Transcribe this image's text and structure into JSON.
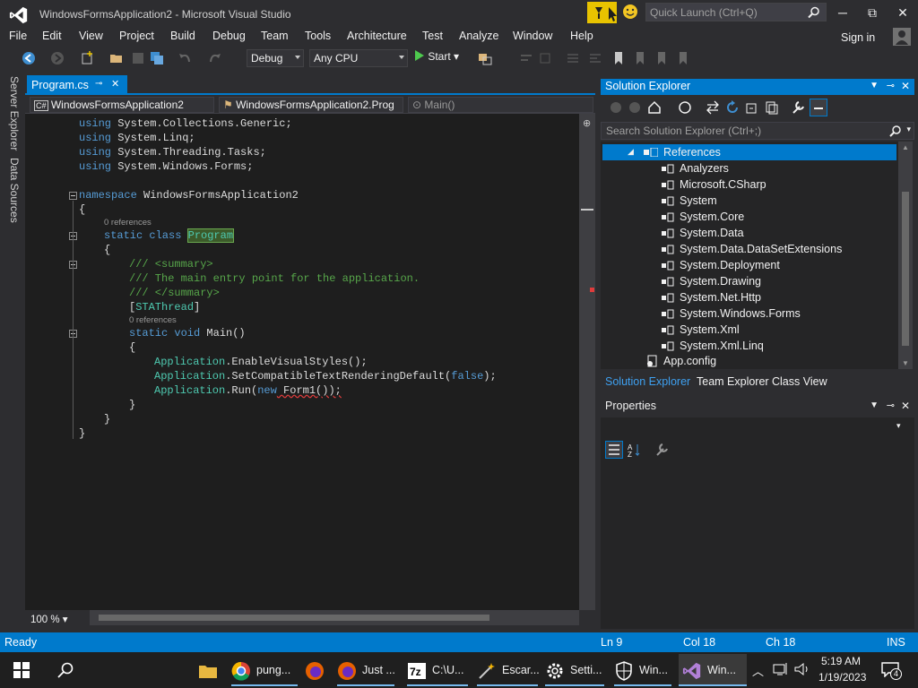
{
  "window": {
    "title": "WindowsFormsApplication2 - Microsoft Visual Studio",
    "quick_launch_placeholder": "Quick Launch (Ctrl+Q)",
    "minimize": "─",
    "maximize": "⧉",
    "close": "✕",
    "sign_in": "Sign in"
  },
  "menu": [
    "File",
    "Edit",
    "View",
    "Project",
    "Build",
    "Debug",
    "Team",
    "Tools",
    "Architecture",
    "Test",
    "Analyze",
    "Window",
    "Help"
  ],
  "toolbar": {
    "config": "Debug",
    "platform": "Any CPU",
    "start": "Start"
  },
  "left_tabs": [
    "Server Explorer",
    "Data Sources"
  ],
  "editor": {
    "tab": "Program.cs",
    "nav_project": "WindowsFormsApplication2",
    "nav_class": "WindowsFormsApplication2.Prog",
    "nav_member": "Main()",
    "zoom": "100 %",
    "lines": {
      "u1_kw": "using",
      "u1": " System.Collections.Generic;",
      "u2_kw": "using",
      "u2": " System.Linq;",
      "u3_kw": "using",
      "u3": " System.Threading.Tasks;",
      "u4_kw": "using",
      "u4": " System.Windows.Forms;",
      "ns_kw": "namespace",
      "ns": " WindowsFormsApplication2",
      "brace_open": "{",
      "refs1": "0 references",
      "cls_kw": "static class",
      "cls_name": "Program",
      "brace2": "{",
      "c1": "/// <summary>",
      "c2": "/// The main entry point for the application.",
      "c3": "/// </summary>",
      "attr_open": "[",
      "attr": "STAThread",
      "attr_close": "]",
      "refs2": "0 references",
      "main_kw": "static void",
      "main": " Main()",
      "brace3": "{",
      "l1_ty": "Application",
      "l1": ".EnableVisualStyles();",
      "l2_ty": "Application",
      "l2a": ".SetCompatibleTextRenderingDefault(",
      "l2_kw": "false",
      "l2b": ");",
      "l3_ty": "Application",
      "l3a": ".Run(",
      "l3_kw": "new",
      "l3b": " Form1());",
      "brace3c": "}",
      "brace2c": "}",
      "brace1c": "}"
    }
  },
  "solution_explorer": {
    "title": "Solution Explorer",
    "search_placeholder": "Search Solution Explorer (Ctrl+;)",
    "selected": "References",
    "items": [
      "Analyzers",
      "Microsoft.CSharp",
      "System",
      "System.Core",
      "System.Data",
      "System.Data.DataSetExtensions",
      "System.Deployment",
      "System.Drawing",
      "System.Net.Http",
      "System.Windows.Forms",
      "System.Xml",
      "System.Xml.Linq"
    ],
    "app_config": "App.config",
    "tabs": [
      "Solution Explorer",
      "Team Explorer",
      "Class View"
    ]
  },
  "properties": {
    "title": "Properties"
  },
  "status": {
    "ready": "Ready",
    "ln": "Ln 9",
    "col": "Col 18",
    "ch": "Ch 18",
    "mode": "INS"
  },
  "taskbar": {
    "apps": [
      "pung...",
      "Just ...",
      "C:\\U...",
      "Escar...",
      "Setti...",
      "Win...",
      "Win..."
    ],
    "time": "5:19 AM",
    "date": "1/19/2023",
    "notifications": "4"
  },
  "colors": {
    "accent": "#007acc",
    "editor_bg": "#1e1e1e",
    "chrome_bg": "#2d2d30",
    "keyword": "#569cd6",
    "type": "#4ec9b0",
    "comment": "#57a64a"
  }
}
